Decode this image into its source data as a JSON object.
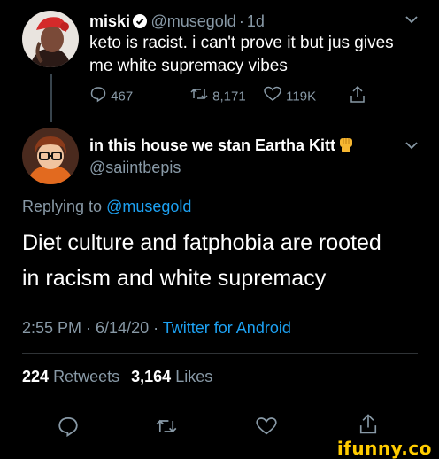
{
  "tweet1": {
    "display_name": "miski",
    "handle": "@musegold",
    "separator": "·",
    "time": "1d",
    "text_line1": "keto is racist. i can't prove it but jus gives",
    "text_line2": "me white supremacy vibes",
    "replies": "467",
    "retweets": "8,171",
    "likes": "119K"
  },
  "tweet2": {
    "display_name": "in this house we stan Eartha Kitt",
    "handle": "@saiintbepis",
    "replying_prefix": "Replying to",
    "replying_to": "@musegold",
    "text_line1": "Diet culture and fatphobia are rooted",
    "text_line2": "in racism and white supremacy",
    "timestamp": "2:55 PM · 6/14/20 ·",
    "source": "Twitter for Android",
    "retweet_count": "224",
    "retweet_label": "Retweets",
    "like_count": "3,164",
    "like_label": "Likes"
  },
  "watermark": "ifunny.co",
  "colors": {
    "background": "#000000",
    "muted": "#8899a6",
    "link": "#1da1f2",
    "watermark": "#ffcc00"
  }
}
